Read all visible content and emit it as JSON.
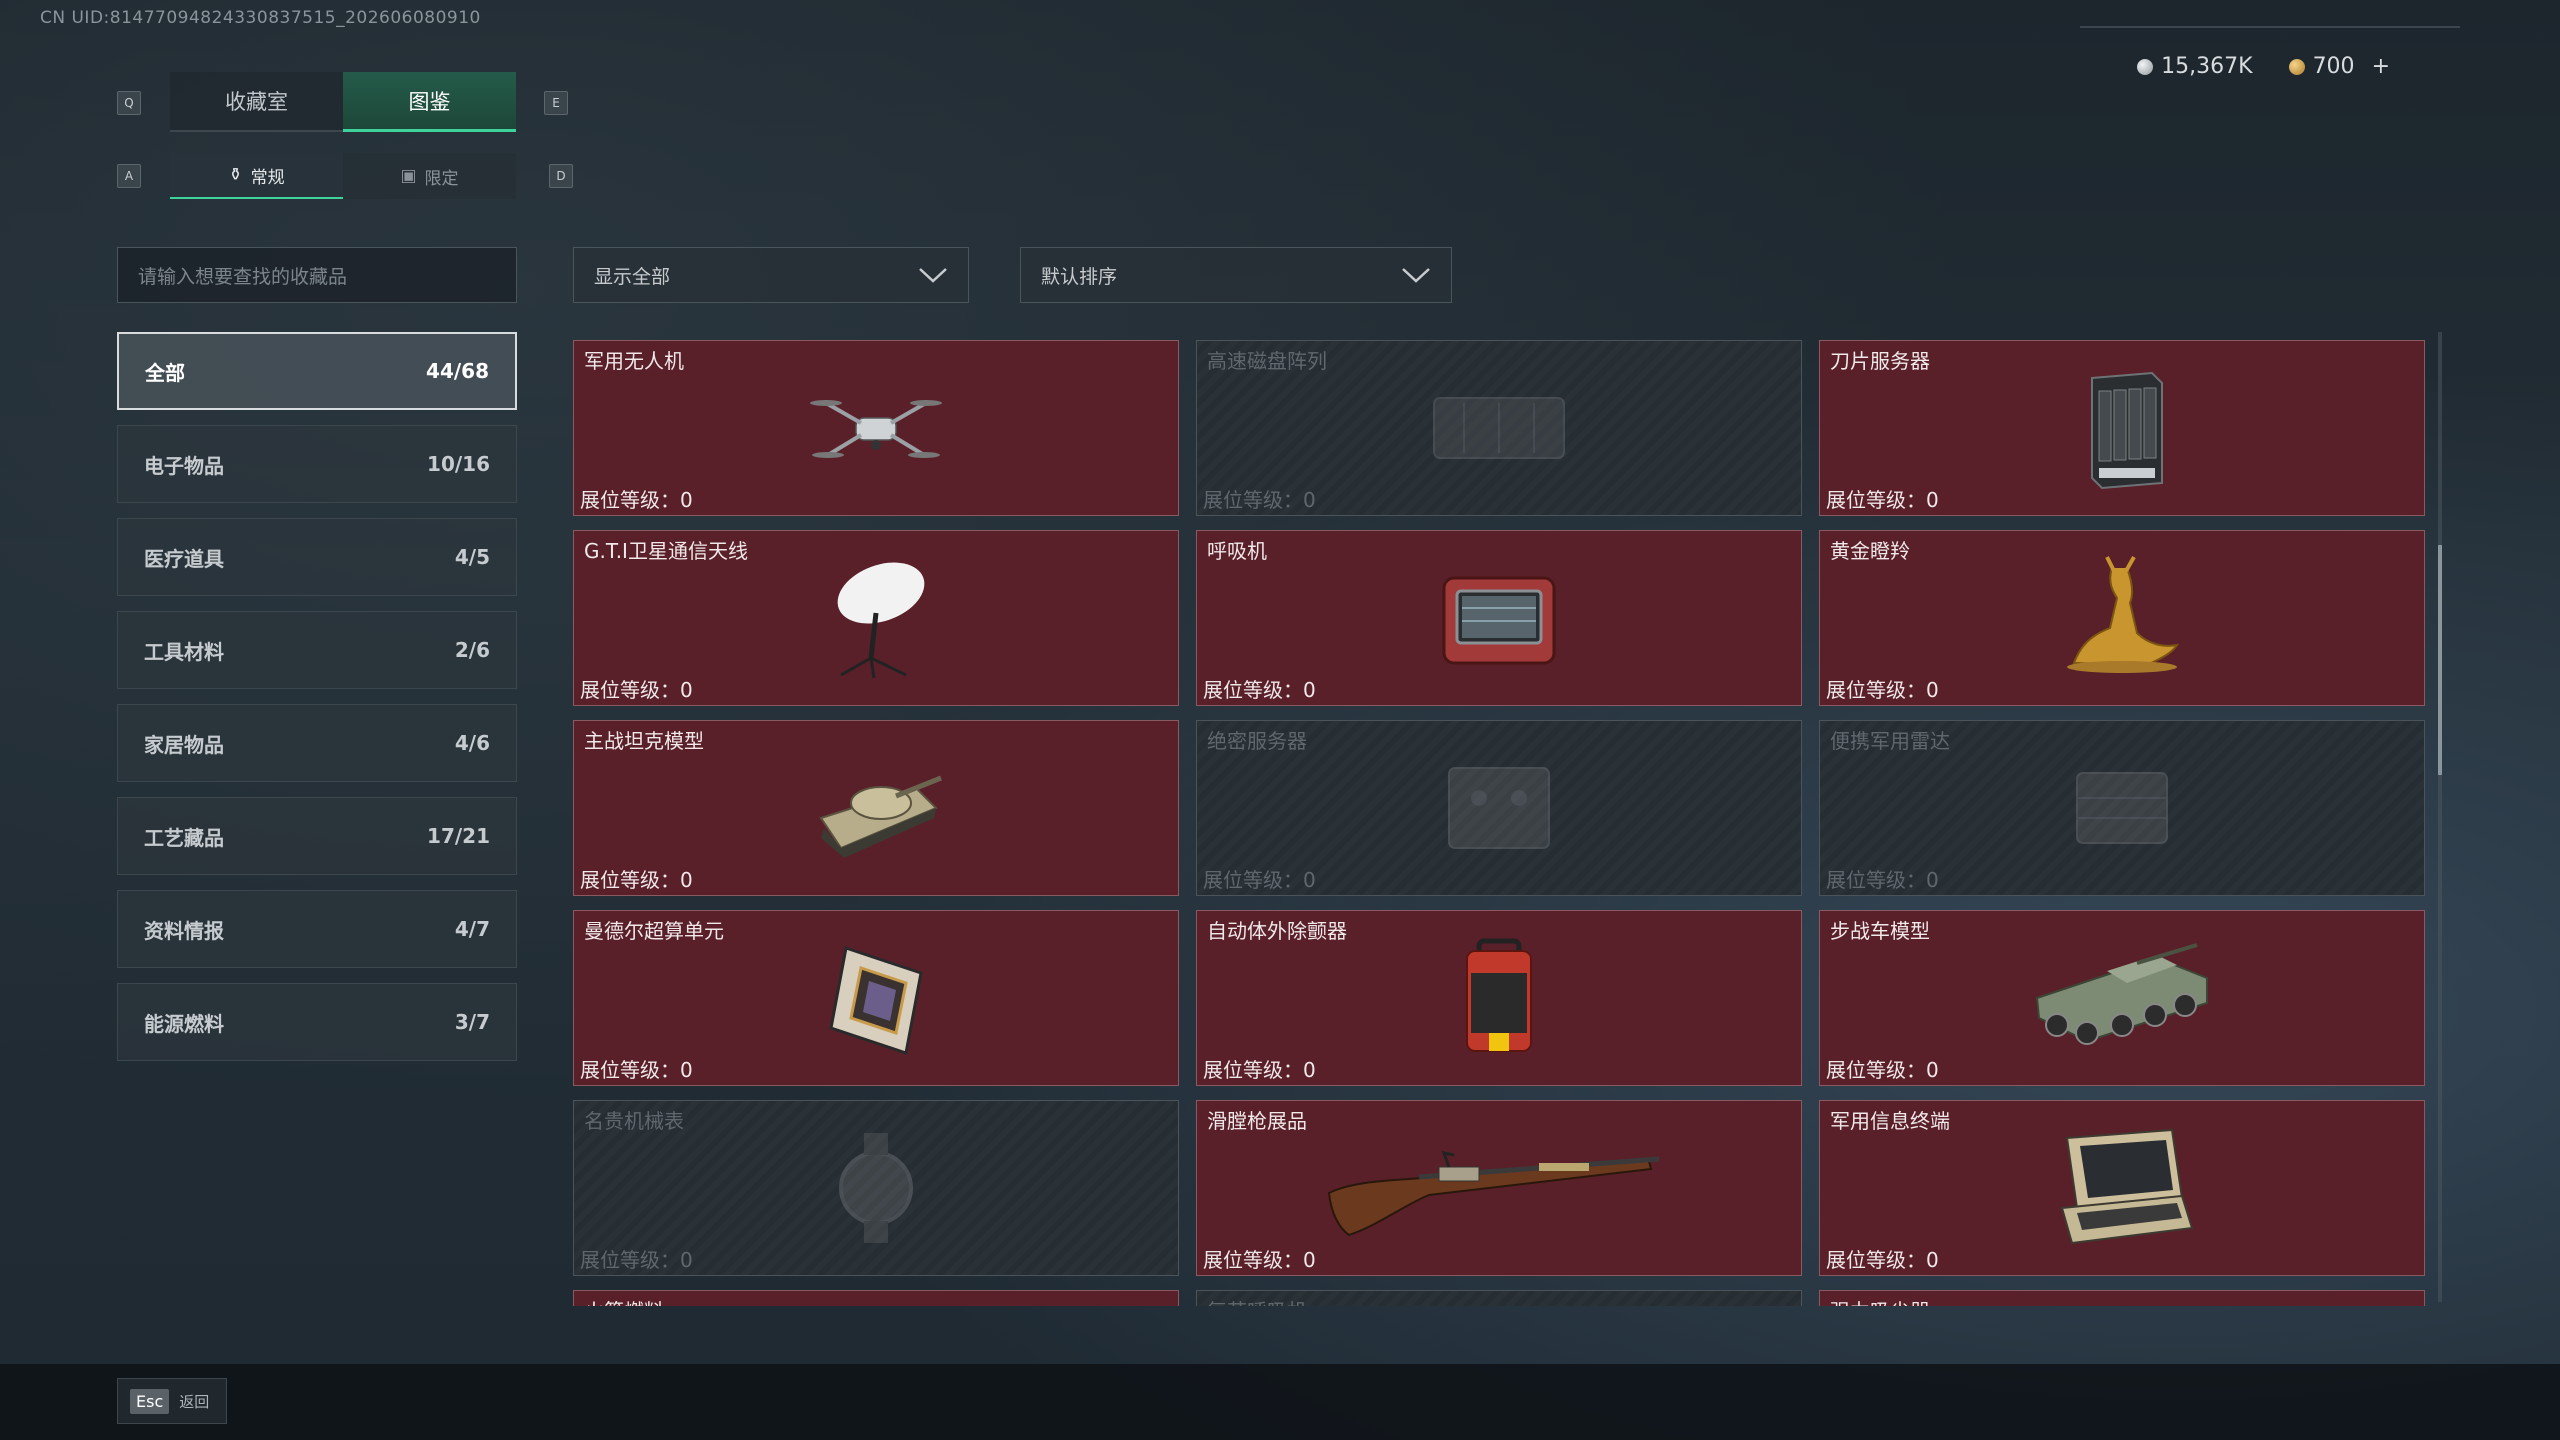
{
  "uid": "CN UID:8147709482433083751​5_202606080910",
  "keys": {
    "q": "Q",
    "e": "E",
    "a": "A",
    "d": "D"
  },
  "tabs": [
    "收藏室",
    "图鉴"
  ],
  "subtabs": [
    "常规",
    "限定"
  ],
  "currency": [
    {
      "value": "15,367K",
      "color": "#c9ced2",
      "icon": "silver-coin-icon"
    },
    {
      "value": "700",
      "color": "#d9a64a",
      "icon": "gold-coin-icon",
      "plus": "+"
    }
  ],
  "search": {
    "placeholder": "请输入想要查找的收藏品"
  },
  "filter": {
    "label": "显示全部"
  },
  "sort": {
    "label": "默认排序"
  },
  "categories": [
    {
      "label": "全部",
      "count": "44/68"
    },
    {
      "label": "电子物品",
      "count": "10/16"
    },
    {
      "label": "医疗道具",
      "count": "4/5"
    },
    {
      "label": "工具材料",
      "count": "2/6"
    },
    {
      "label": "家居物品",
      "count": "4/6"
    },
    {
      "label": "工艺藏品",
      "count": "17/21"
    },
    {
      "label": "资料情报",
      "count": "4/7"
    },
    {
      "label": "能源燃料",
      "count": "3/7"
    }
  ],
  "items": [
    {
      "name": "军用无人机",
      "level": "展位等级：0",
      "locked": false,
      "icon": "drone-icon"
    },
    {
      "name": "高速磁盘阵列",
      "level": "展位等级：0",
      "locked": true,
      "icon": "disk-array-icon"
    },
    {
      "name": "刀片服务器",
      "level": "展位等级：0",
      "locked": false,
      "icon": "server-icon"
    },
    {
      "name": "G.T.I卫星通信天线",
      "level": "展位等级：0",
      "locked": false,
      "icon": "satellite-dish-icon"
    },
    {
      "name": "呼吸机",
      "level": "展位等级：0",
      "locked": false,
      "icon": "ventilator-icon"
    },
    {
      "name": "黄金瞪羚",
      "level": "展位等级：0",
      "locked": false,
      "icon": "golden-gazelle-icon"
    },
    {
      "name": "主战坦克模型",
      "level": "展位等级：0",
      "locked": false,
      "icon": "tank-icon"
    },
    {
      "name": "绝密服务器",
      "level": "展位等级：0",
      "locked": true,
      "icon": "secret-server-icon"
    },
    {
      "name": "便携军用雷达",
      "level": "展位等级：0",
      "locked": true,
      "icon": "radar-icon"
    },
    {
      "name": "曼德尔超算单元",
      "level": "展位等级：0",
      "locked": false,
      "icon": "supercomputer-chip-icon"
    },
    {
      "name": "自动体外除颤器",
      "level": "展位等级：0",
      "locked": false,
      "icon": "defibrillator-icon"
    },
    {
      "name": "步战车模型",
      "level": "展位等级：0",
      "locked": false,
      "icon": "ifv-icon"
    },
    {
      "name": "名贵机械表",
      "level": "展位等级：0",
      "locked": true,
      "icon": "watch-icon"
    },
    {
      "name": "滑膛枪展品",
      "level": "展位等级：0",
      "locked": false,
      "icon": "musket-icon"
    },
    {
      "name": "军用信息终端",
      "level": "展位等级：0",
      "locked": false,
      "icon": "terminal-icon"
    },
    {
      "name": "火箭燃料",
      "level": "",
      "locked": false,
      "icon": "rocket-fuel-icon"
    },
    {
      "name": "复苏呼吸机",
      "level": "",
      "locked": true,
      "icon": "respirator-icon"
    },
    {
      "name": "强力吸尘器",
      "level": "",
      "locked": false,
      "icon": "vacuum-icon"
    }
  ],
  "footer": {
    "key": "Esc",
    "label": "返回"
  }
}
